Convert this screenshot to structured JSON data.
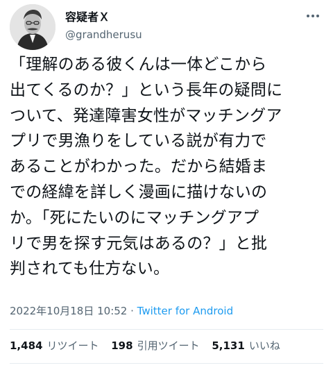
{
  "user": {
    "display_name": "容疑者Ｘ",
    "handle": "@grandherusu"
  },
  "tweet": {
    "lines": [
      "「理解のある彼くんは一体どこから",
      "出てくるのか？」という長年の疑問に",
      "ついて、発達障害女性がマッチングア",
      "プリで男漁りをしている説が有力で",
      "あることがわかった。だから結婚ま",
      "での経緯を詳しく漫画に描けないの",
      "か。「死にたいのにマッチングアプ",
      "リで男を探す元気はあるの？」と批",
      "判されても仕方ない。"
    ],
    "timestamp": "2022年10月18日 10:52",
    "separator": " · ",
    "source": "Twitter for Android"
  },
  "stats": {
    "retweets_count": "1,484",
    "retweets_label": "リツイート",
    "quotes_count": "198",
    "quotes_label": "引用ツイート",
    "likes_count": "5,131",
    "likes_label": "いいね"
  },
  "icons": {
    "avatar": "profile-photo",
    "more": "more-options-icon"
  },
  "colors": {
    "text": "#0f1419",
    "secondary": "#536471",
    "link": "#1d9bf0"
  }
}
